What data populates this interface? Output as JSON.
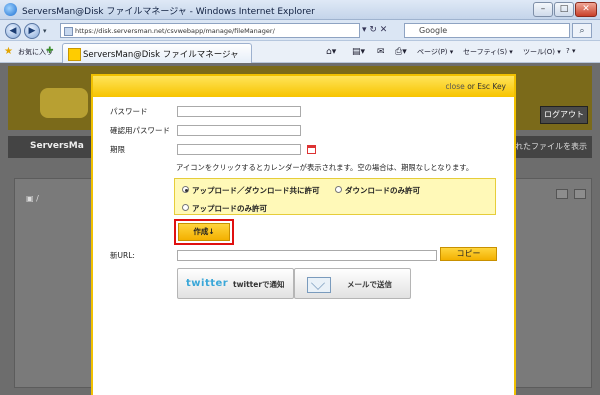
{
  "browser": {
    "window_title": "ServersMan@Disk ファイルマネージャ - Windows Internet Explorer",
    "url": "https://disk.serversman.net/csvwebapp/manage/fileManager/",
    "search_placeholder": "Google",
    "favorites_label": "お気に入り",
    "tab_title": "ServersMan@Disk ファイルマネージャ",
    "commands": [
      "ページ(P) ▾",
      "セーフティ(S) ▾",
      "ツール(O) ▾",
      "? ▾"
    ]
  },
  "background_page": {
    "login_button": "ログアウト",
    "nav_left": "ServersMa",
    "nav_right": "れたファイルを表示",
    "tree_root": "/"
  },
  "modal": {
    "close_link": "close",
    "close_link_suffix": "or Esc Key",
    "password_label": "パスワード",
    "password_confirm_label": "確認用パスワード",
    "expiry_label": "期限",
    "calendar_hint": "アイコンをクリックするとカレンダーが表示されます。空の場合は、期限なしとなります。",
    "permission_options": [
      {
        "label": "アップロード／ダウンロード共に許可",
        "selected": true
      },
      {
        "label": "ダウンロードのみ許可",
        "selected": false
      },
      {
        "label": "アップロードのみ許可",
        "selected": false
      }
    ],
    "create_button": "作成↓",
    "new_url_label": "新URL:",
    "copy_button": "コピー",
    "twitter_logo_text": "twitter",
    "twitter_button": "twitterで通知",
    "mail_button": "メールで送信"
  },
  "colors": {
    "accent_yellow": "#f7c400",
    "highlight_red": "#e01010"
  }
}
